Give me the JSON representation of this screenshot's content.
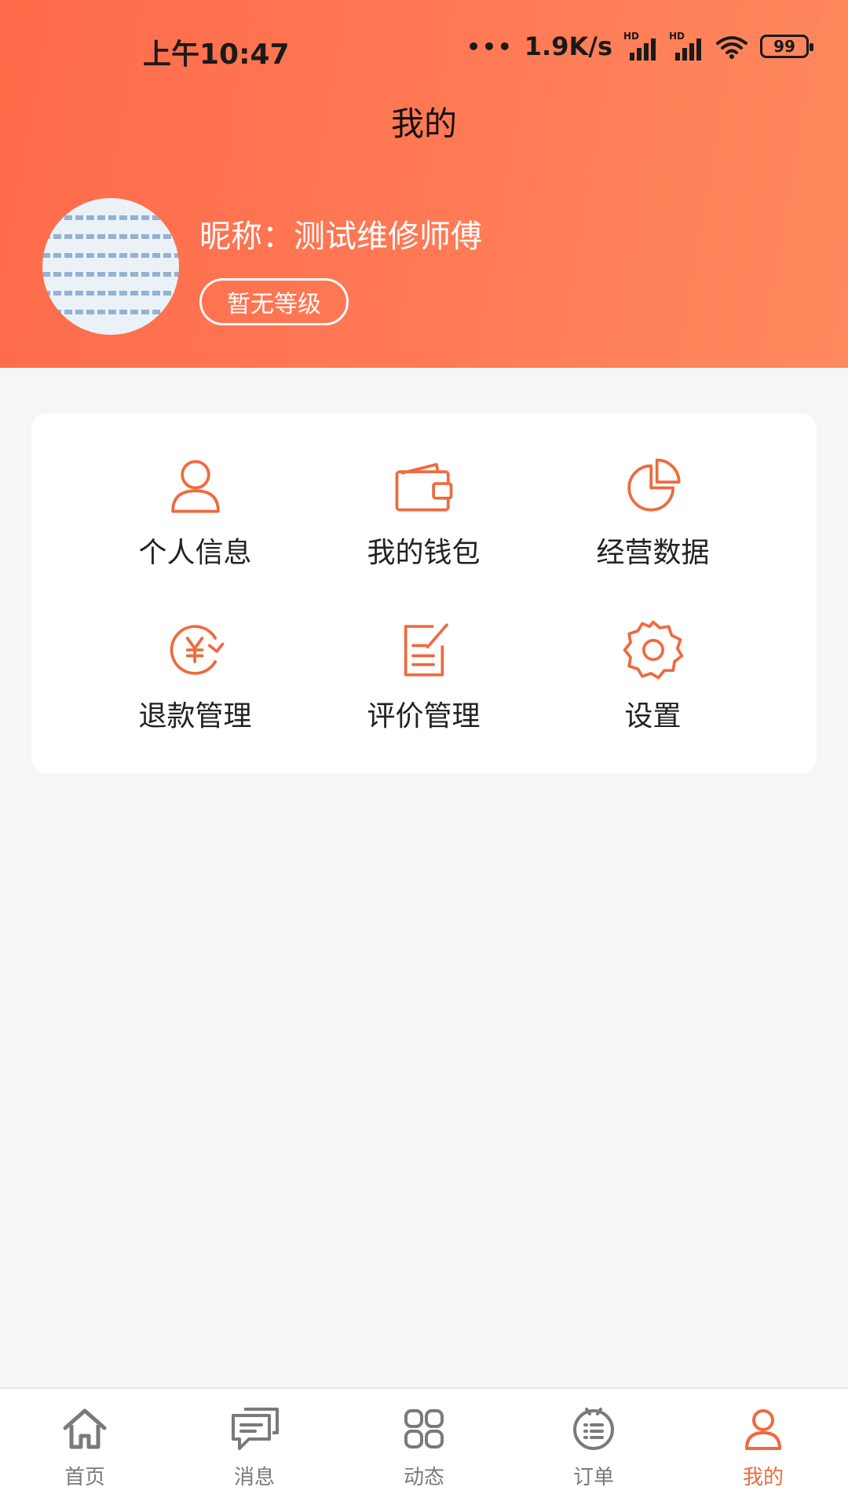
{
  "status_bar": {
    "time": "上午10:47",
    "dots": "•••",
    "speed": "1.9K/s",
    "hd1": "HD",
    "hd2": "HD",
    "battery": "99"
  },
  "header": {
    "title": "我的",
    "nickname": "昵称：测试维修师傅",
    "level": "暂无等级"
  },
  "menu": {
    "items": [
      {
        "label": "个人信息",
        "icon": "person-icon"
      },
      {
        "label": "我的钱包",
        "icon": "wallet-icon"
      },
      {
        "label": "经营数据",
        "icon": "pie-chart-icon"
      },
      {
        "label": "退款管理",
        "icon": "refund-icon"
      },
      {
        "label": "评价管理",
        "icon": "edit-note-icon"
      },
      {
        "label": "设置",
        "icon": "gear-icon"
      }
    ]
  },
  "tabbar": {
    "items": [
      {
        "label": "首页",
        "icon": "home-icon"
      },
      {
        "label": "消息",
        "icon": "chat-icon"
      },
      {
        "label": "动态",
        "icon": "apps-icon"
      },
      {
        "label": "订单",
        "icon": "order-icon"
      },
      {
        "label": "我的",
        "icon": "person-icon",
        "active": true
      }
    ]
  },
  "colors": {
    "accent": "#ef6a3f",
    "header_start": "#ff6b4a",
    "header_end": "#ff8a5e",
    "inactive": "#7a7a7a"
  }
}
